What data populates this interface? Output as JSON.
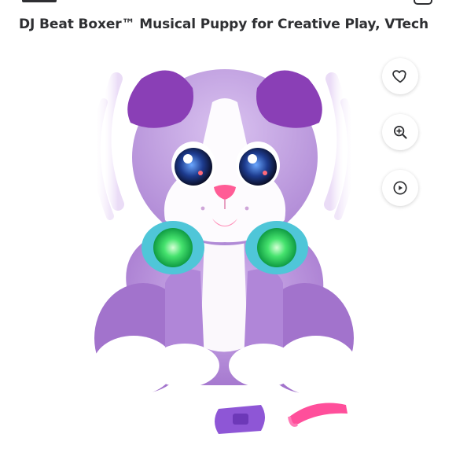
{
  "product": {
    "title": "DJ Beat Boxer™ Musical Puppy for Creative Play, VTech"
  },
  "actions": [
    {
      "name": "favorite",
      "icon": "heart-icon"
    },
    {
      "name": "zoom",
      "icon": "zoom-in-icon"
    },
    {
      "name": "play-video",
      "icon": "play-circle-icon"
    }
  ],
  "colors": {
    "title_text": "#2e2f32",
    "plush_purple": "#b48fd6",
    "plush_dark_purple": "#8a3fb6",
    "headphone_teal": "#4fc6d8",
    "headphone_green": "#3cd66a",
    "bracelet_pink": "#ff4f9b",
    "bracelet_purple": "#8e56d6"
  }
}
